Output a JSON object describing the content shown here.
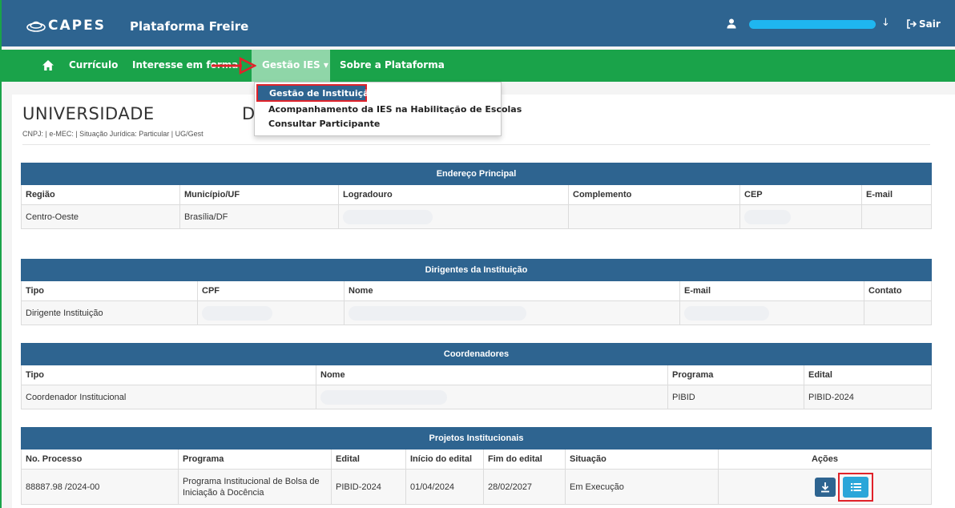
{
  "header": {
    "logo_text": "CAPES",
    "platform_name": "Plataforma Freire",
    "logout_label": "Sair",
    "brand_color": "#2e6490",
    "nav_color": "#1aa34a"
  },
  "nav": {
    "items": [
      "Currículo",
      "Interesse em formação",
      "Gestão IES ▾",
      "Sobre a Plataforma"
    ]
  },
  "dropdown": {
    "items": [
      "Gestão de Instituição",
      "Acompanhamento da IES na Habilitação de Escolas",
      "Consultar Participante"
    ]
  },
  "institution": {
    "name_part1": "UNIVERSIDADE",
    "name_part2": "D",
    "info": "CNPJ: | e-MEC: | Situação Jurídica: Particular | UG/Gest"
  },
  "address_table": {
    "title": "Endereço Principal",
    "headers": [
      "Região",
      "Município/UF",
      "Logradouro",
      "Complemento",
      "CEP",
      "E-mail"
    ],
    "rows": [
      [
        "Centro-Oeste",
        "Brasília/DF",
        "",
        "",
        "",
        ""
      ]
    ]
  },
  "leaders_table": {
    "title": "Dirigentes da Instituição",
    "headers": [
      "Tipo",
      "CPF",
      "Nome",
      "E-mail",
      "Contato"
    ],
    "rows": [
      [
        "Dirigente Instituição",
        "",
        "",
        "",
        ""
      ]
    ]
  },
  "coordinators_table": {
    "title": "Coordenadores",
    "headers": [
      "Tipo",
      "Nome",
      "Programa",
      "Edital"
    ],
    "rows": [
      [
        "Coordenador Institucional",
        "",
        "PIBID",
        "PIBID-2024"
      ]
    ]
  },
  "projects_table": {
    "title": "Projetos Institucionais",
    "headers": [
      "No. Processo",
      "Programa",
      "Edital",
      "Início do edital",
      "Fim do edital",
      "Situação",
      "Ações"
    ],
    "rows": [
      [
        "88887.98 /2024-00",
        "Programa Institucional de Bolsa de Iniciação à Docência",
        "PIBID-2024",
        "01/04/2024",
        "28/02/2027",
        "Em Execução"
      ]
    ]
  },
  "icons": [
    "capes-logo-icon",
    "user-icon",
    "chevron-down-icon",
    "logout-icon",
    "home-icon",
    "download-icon",
    "list-icon"
  ]
}
